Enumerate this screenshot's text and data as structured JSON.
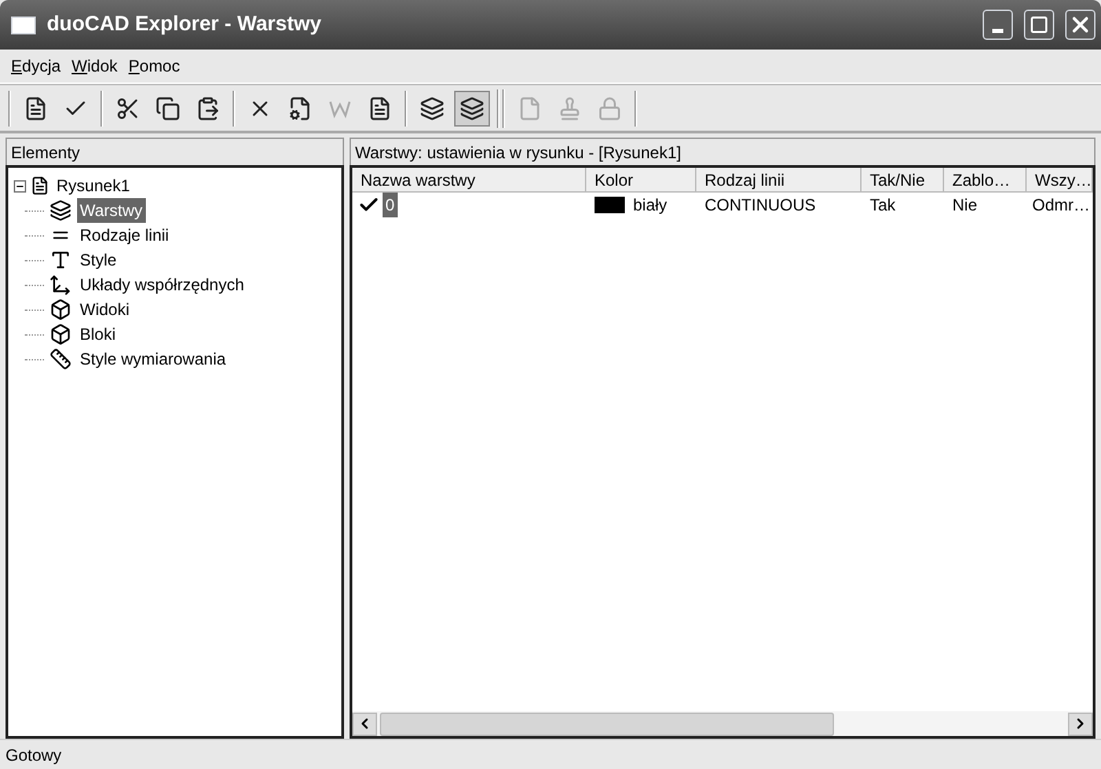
{
  "window": {
    "title": "duoCAD Explorer - Warstwy"
  },
  "menu": [
    {
      "accel": "E",
      "rest": "dycja"
    },
    {
      "accel": "W",
      "rest": "idok"
    },
    {
      "accel": "P",
      "rest": "omoc"
    }
  ],
  "toolbar": [
    {
      "kind": "sep"
    },
    {
      "kind": "new-doc",
      "disabled": false,
      "pressed": false
    },
    {
      "kind": "check",
      "disabled": false,
      "pressed": false
    },
    {
      "kind": "sep"
    },
    {
      "kind": "cut",
      "disabled": false,
      "pressed": false
    },
    {
      "kind": "copy",
      "disabled": false,
      "pressed": false
    },
    {
      "kind": "paste",
      "disabled": false,
      "pressed": false
    },
    {
      "kind": "sep"
    },
    {
      "kind": "delete",
      "disabled": false,
      "pressed": false
    },
    {
      "kind": "properties",
      "disabled": false,
      "pressed": false
    },
    {
      "kind": "letter",
      "disabled": true,
      "pressed": false
    },
    {
      "kind": "new-doc",
      "disabled": false,
      "pressed": false
    },
    {
      "kind": "sep"
    },
    {
      "kind": "layer",
      "disabled": false,
      "pressed": false
    },
    {
      "kind": "layer-off",
      "disabled": false,
      "pressed": true
    },
    {
      "kind": "sep2"
    },
    {
      "kind": "page",
      "disabled": true,
      "pressed": false
    },
    {
      "kind": "stamp",
      "disabled": true,
      "pressed": false
    },
    {
      "kind": "lock",
      "disabled": true,
      "pressed": false
    },
    {
      "kind": "sep"
    }
  ],
  "tree_panel": {
    "header": "Elementy",
    "root": {
      "label": "Rysunek1",
      "expanded": true,
      "selected": false,
      "children": [
        {
          "label": "Warstwy",
          "kind": "layers",
          "selected": true
        },
        {
          "label": "Rodzaje linii",
          "kind": "lines",
          "selected": false
        },
        {
          "label": "Style",
          "kind": "font",
          "selected": false
        },
        {
          "label": "Układy współrzędnych",
          "kind": "axes",
          "selected": false
        },
        {
          "label": "Widoki",
          "kind": "view",
          "selected": false
        },
        {
          "label": "Bloki",
          "kind": "block",
          "selected": false
        },
        {
          "label": "Style wymiarowania",
          "kind": "dimension",
          "selected": false
        }
      ]
    }
  },
  "list_panel": {
    "header": "Warstwy: ustawienia w rysunku - [Rysunek1]",
    "columns": [
      "Nazwa warstwy",
      "Kolor",
      "Rodzaj linii",
      "Tak/Nie",
      "Zablo…",
      "Wszy…"
    ],
    "rows": [
      {
        "current": true,
        "name": "0",
        "selected": true,
        "color": "#000000",
        "color_name": "biały",
        "linetype": "CONTINUOUS",
        "on": "Tak",
        "locked": "Nie",
        "column_6": "Odmr…"
      }
    ]
  },
  "status_bar": "Gotowy"
}
